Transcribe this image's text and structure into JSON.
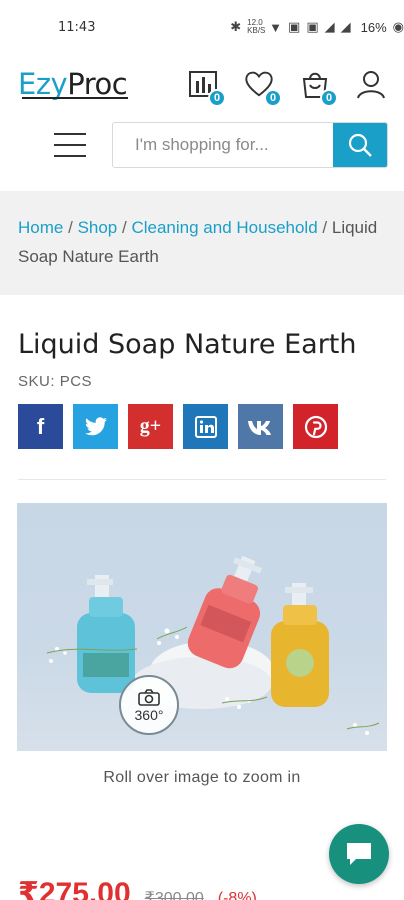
{
  "status_bar": {
    "time": "11:43",
    "data_speed": "12.0 KB/S",
    "battery": "16%"
  },
  "header": {
    "logo_text_a": "Ezy",
    "logo_text_b": "Proc",
    "compare_count": "0",
    "wishlist_count": "0",
    "cart_count": "0"
  },
  "search": {
    "placeholder": "I'm shopping for..."
  },
  "breadcrumb": {
    "home": "Home",
    "shop": "Shop",
    "category": "Cleaning and Household",
    "current": "Liquid Soap Nature Earth",
    "separator": "/"
  },
  "product": {
    "title": "Liquid Soap Nature Earth",
    "sku_label": "SKU:",
    "sku_value": "PCS",
    "badge_360": "360°",
    "zoom_hint": "Roll over image to zoom in",
    "price": "₹275.00",
    "old_price": "₹300.00",
    "discount": "(-8%)"
  },
  "share": {
    "facebook": "f",
    "googleplus": "g+",
    "colors": {
      "facebook": "#2b4b9a",
      "twitter": "#27a2e1",
      "googleplus": "#d32f2f",
      "linkedin": "#1f76b8",
      "vk": "#4f77a8",
      "pinterest": "#d2232b"
    }
  },
  "theme": {
    "accent": "#1a9fc9",
    "price_red": "#e0302f",
    "chat_green": "#17917e"
  }
}
